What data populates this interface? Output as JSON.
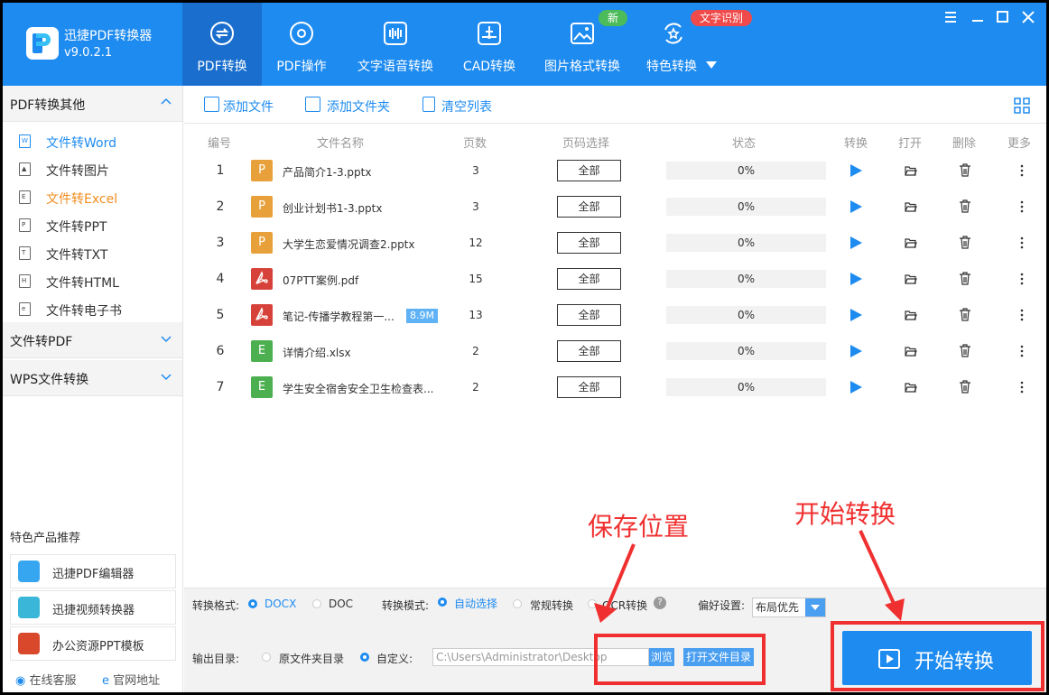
{
  "app": {
    "title": "迅捷PDF转换器",
    "version": "v9.0.2.1"
  },
  "tabs": [
    {
      "label": "PDF转换",
      "icon": "pdf-convert-icon"
    },
    {
      "label": "PDF操作",
      "icon": "gear-icon"
    },
    {
      "label": "文字语音转换",
      "icon": "audio-wave-icon"
    },
    {
      "label": "CAD转换",
      "icon": "cad-icon"
    },
    {
      "label": "图片格式转换",
      "icon": "image-icon"
    },
    {
      "label": "特色转换",
      "icon": "star-convert-icon"
    }
  ],
  "badges": {
    "new": "新",
    "ocr": "文字识别"
  },
  "sidebar": {
    "group1": "PDF转换其他",
    "items": [
      {
        "label": "文件转Word",
        "color": "#1e8bf0"
      },
      {
        "label": "文件转图片"
      },
      {
        "label": "文件转Excel",
        "color": "#f08c1e"
      },
      {
        "label": "文件转PPT"
      },
      {
        "label": "文件转TXT"
      },
      {
        "label": "文件转HTML"
      },
      {
        "label": "文件转电子书"
      }
    ],
    "group2": "文件转PDF",
    "group3": "WPS文件转换",
    "rec_title": "特色产品推荐",
    "recs": [
      "迅捷PDF编辑器",
      "迅捷视频转换器",
      "办公资源PPT模板"
    ],
    "service": "在线客服",
    "website": "官网地址"
  },
  "toolbar": {
    "add_file": "添加文件",
    "add_folder": "添加文件夹",
    "clear_list": "清空列表"
  },
  "table": {
    "headers": {
      "num": "编号",
      "name": "文件名称",
      "pages": "页数",
      "page_select": "页码选择",
      "status": "状态",
      "convert": "转换",
      "open": "打开",
      "delete": "删除",
      "more": "更多"
    },
    "rows": [
      {
        "num": "1",
        "type": "P",
        "color": "#e8a03a",
        "name": "产品简介1-3.pptx",
        "size": "",
        "pages": "3",
        "select": "全部",
        "status": "0%"
      },
      {
        "num": "2",
        "type": "P",
        "color": "#e8a03a",
        "name": "创业计划书1-3.pptx",
        "size": "",
        "pages": "3",
        "select": "全部",
        "status": "0%"
      },
      {
        "num": "3",
        "type": "P",
        "color": "#e8a03a",
        "name": "大学生恋爱情况调查2.pptx",
        "size": "",
        "pages": "12",
        "select": "全部",
        "status": "0%"
      },
      {
        "num": "4",
        "type": "pdf",
        "color": "#d6423a",
        "name": "07PTT案例.pdf",
        "size": "",
        "pages": "15",
        "select": "全部",
        "status": "0%"
      },
      {
        "num": "5",
        "type": "pdf",
        "color": "#d6423a",
        "name": "笔记-传播学教程第一...",
        "size": "8.9M",
        "pages": "13",
        "select": "全部",
        "status": "0%"
      },
      {
        "num": "6",
        "type": "E",
        "color": "#4caf50",
        "name": "详情介绍.xlsx",
        "size": "",
        "pages": "2",
        "select": "全部",
        "status": "0%"
      },
      {
        "num": "7",
        "type": "E",
        "color": "#4caf50",
        "name": "学生安全宿舍安全卫生检查表...",
        "size": "",
        "pages": "2",
        "select": "全部",
        "status": "0%"
      }
    ]
  },
  "options": {
    "format_label": "转换格式:",
    "format_docx": "DOCX",
    "format_doc": "DOC",
    "mode_label": "转换模式:",
    "mode_auto": "自动选择",
    "mode_normal": "常规转换",
    "mode_ocr": "OCR转换",
    "pref_label": "偏好设置:",
    "pref_value": "布局优先",
    "output_label": "输出目录:",
    "out_source": "原文件夹目录",
    "out_custom": "自定义:",
    "path": "C:\\Users\\Administrator\\Desktop",
    "browse": "浏览",
    "open_dir": "打开文件目录"
  },
  "start_button": "开始转换",
  "annotations": {
    "save_location": "保存位置",
    "start_convert": "开始转换"
  }
}
